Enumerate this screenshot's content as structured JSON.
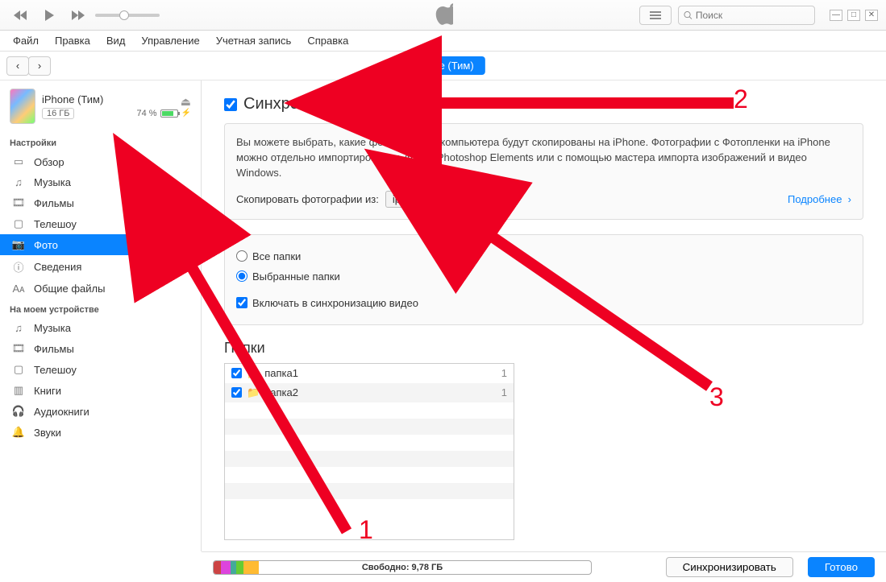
{
  "menu": {
    "file": "Файл",
    "edit": "Правка",
    "view": "Вид",
    "controls": "Управление",
    "account": "Учетная запись",
    "help": "Справка"
  },
  "search_placeholder": "Поиск",
  "device_pill": "iPhone (Тим)",
  "device": {
    "name": "iPhone (Тим)",
    "capacity": "16 ГБ",
    "battery": "74 %"
  },
  "sidebar": {
    "settings_head": "Настройки",
    "settings": [
      {
        "label": "Обзор"
      },
      {
        "label": "Музыка"
      },
      {
        "label": "Фильмы"
      },
      {
        "label": "Телешоу"
      },
      {
        "label": "Фото"
      },
      {
        "label": "Сведения"
      },
      {
        "label": "Общие файлы"
      }
    ],
    "ondevice_head": "На моем устройстве",
    "ondevice": [
      {
        "label": "Музыка"
      },
      {
        "label": "Фильмы"
      },
      {
        "label": "Телешоу"
      },
      {
        "label": "Книги"
      },
      {
        "label": "Аудиокниги"
      },
      {
        "label": "Звуки"
      }
    ]
  },
  "sync": {
    "title": "Синхронизировать",
    "desc": "Вы можете выбрать, какие фотографии с компьютера будут скопированы на iPhone. Фотографии с Фотопленки на iPhone можно отдельно импортировать в Adobe Photoshop Elements или с помощью мастера импорта изображений и видео Windows.",
    "src_label": "Скопировать фотографии из:",
    "src_value": "iphone",
    "photo_count": "Фото: 2",
    "more": "Подробнее",
    "opt_all": "Все папки",
    "opt_selected": "Выбранные папки",
    "opt_video": "Включать в синхронизацию видео"
  },
  "folders": {
    "head": "Папки",
    "list": [
      {
        "name": "папка1",
        "count": "1"
      },
      {
        "name": "папка2",
        "count": "1"
      }
    ]
  },
  "bottom": {
    "free": "Свободно: 9,78 ГБ",
    "sync_btn": "Синхронизировать",
    "done_btn": "Готово"
  },
  "annotations": {
    "n1": "1",
    "n2": "2",
    "n3": "3"
  }
}
